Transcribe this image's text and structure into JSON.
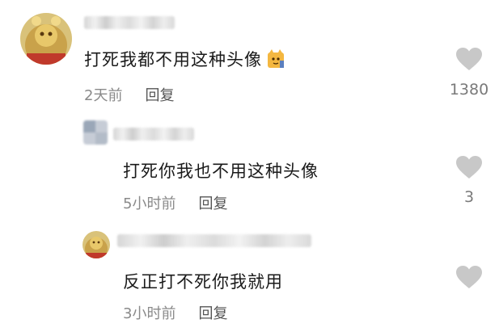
{
  "colors": {
    "heart": "#c8c8c8",
    "text": "#1a1a1a",
    "meta": "#8a8a8a",
    "count": "#7a7a7a"
  },
  "comments": [
    {
      "text": "打死我都不用这种头像",
      "emoji": "cat-emoji",
      "time": "2天前",
      "reply_label": "回复",
      "likes": "1380"
    },
    {
      "text": "打死你我也不用这种头像",
      "time": "5小时前",
      "reply_label": "回复",
      "likes": "3"
    },
    {
      "text": "反正打不死你我就用",
      "time": "3小时前",
      "reply_label": "回复",
      "likes": ""
    }
  ]
}
